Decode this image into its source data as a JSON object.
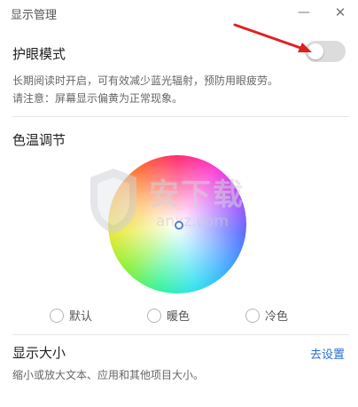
{
  "window": {
    "title": "显示管理",
    "minimize_symbol": "—",
    "close_symbol": "✕"
  },
  "eye_protection": {
    "title": "护眼模式",
    "description_line1": "长期阅读时开启，可有效减少蓝光辐射，预防用眼疲劳。",
    "description_line2": "请注意：屏幕显示偏黄为正常现象。",
    "toggle_on": false
  },
  "color_temperature": {
    "title": "色温调节",
    "options": [
      {
        "label": "默认",
        "selected": false
      },
      {
        "label": "暖色",
        "selected": false
      },
      {
        "label": "冷色",
        "selected": false
      }
    ]
  },
  "display_size": {
    "title": "显示大小",
    "link_label": "去设置",
    "description": "缩小或放大文本、应用和其他项目大小。"
  },
  "watermark": {
    "text": "安下载",
    "sub": "anxz.com"
  },
  "colors": {
    "accent_link": "#2b6cd6",
    "annotation_arrow": "#e02020"
  }
}
